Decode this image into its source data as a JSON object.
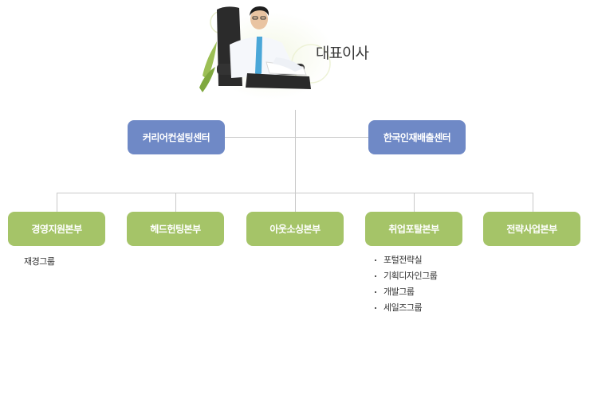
{
  "ceo": {
    "label": "대표이사"
  },
  "centers": [
    {
      "label": "커리어컨설팅센터"
    },
    {
      "label": "한국인재배출센터"
    }
  ],
  "divisions": [
    {
      "label": "경영지원본부"
    },
    {
      "label": "헤드헌팅본부"
    },
    {
      "label": "아웃소싱본부"
    },
    {
      "label": "취업포탈본부"
    },
    {
      "label": "전략사업본부"
    }
  ],
  "management_sub": "재경그룹",
  "portal_subs": [
    "포털전략실",
    "기획디자인그룹",
    "개발그룹",
    "세일즈그룹"
  ],
  "colors": {
    "center": "#6f89c6",
    "division": "#a5c468",
    "line": "#c9c9c9"
  }
}
